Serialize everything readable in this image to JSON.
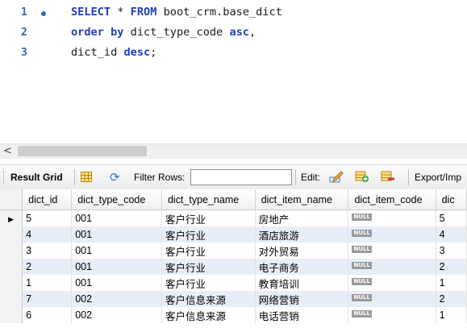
{
  "editor": {
    "lines": [
      {
        "num": "1",
        "tokens": [
          {
            "t": "SELECT",
            "kw": true
          },
          {
            "t": " * ",
            "kw": false
          },
          {
            "t": "FROM",
            "kw": true
          },
          {
            "t": " boot_crm.base_dict",
            "kw": false
          }
        ]
      },
      {
        "num": "2",
        "tokens": [
          {
            "t": "order by",
            "kw": true
          },
          {
            "t": " dict_type_code ",
            "kw": false
          },
          {
            "t": "asc",
            "kw": true
          },
          {
            "t": ",",
            "kw": false
          }
        ]
      },
      {
        "num": "3",
        "tokens": [
          {
            "t": "dict_id ",
            "kw": false
          },
          {
            "t": "desc",
            "kw": true
          },
          {
            "t": ";",
            "kw": false
          }
        ]
      }
    ]
  },
  "scrollbar": {
    "left_arrow": "<"
  },
  "toolbar": {
    "result_grid": "Result Grid",
    "filter_rows": "Filter Rows:",
    "filter_value": "",
    "edit": "Edit:",
    "export": "Export/Imp"
  },
  "grid": {
    "columns": [
      "dict_id",
      "dict_type_code",
      "dict_type_name",
      "dict_item_name",
      "dict_item_code",
      "dic"
    ],
    "null_text": "NULL",
    "rows": [
      {
        "dict_id": "5",
        "dict_type_code": "001",
        "dict_type_name": "客户行业",
        "dict_item_name": "房地产",
        "dict_item_code": null,
        "dic": "5"
      },
      {
        "dict_id": "4",
        "dict_type_code": "001",
        "dict_type_name": "客户行业",
        "dict_item_name": "酒店旅游",
        "dict_item_code": null,
        "dic": "4"
      },
      {
        "dict_id": "3",
        "dict_type_code": "001",
        "dict_type_name": "客户行业",
        "dict_item_name": "对外贸易",
        "dict_item_code": null,
        "dic": "3"
      },
      {
        "dict_id": "2",
        "dict_type_code": "001",
        "dict_type_name": "客户行业",
        "dict_item_name": "电子商务",
        "dict_item_code": null,
        "dic": "2"
      },
      {
        "dict_id": "1",
        "dict_type_code": "001",
        "dict_type_name": "客户行业",
        "dict_item_name": "教育培训",
        "dict_item_code": null,
        "dic": "1"
      },
      {
        "dict_id": "7",
        "dict_type_code": "002",
        "dict_type_name": "客户信息来源",
        "dict_item_name": "网络营销",
        "dict_item_code": null,
        "dic": "2"
      },
      {
        "dict_id": "6",
        "dict_type_code": "002",
        "dict_type_name": "客户信息来源",
        "dict_item_name": "电话营销",
        "dict_item_code": null,
        "dic": "1"
      }
    ],
    "selected_row": 0
  },
  "colors": {
    "keyword": "#1f3fc0",
    "line_number": "#2b6bb5",
    "alt_row": "#e7eef8"
  },
  "icons": [
    "grid-view-icon",
    "refresh-icon",
    "edit-pencil-icon",
    "add-row-icon",
    "delete-row-icon"
  ]
}
